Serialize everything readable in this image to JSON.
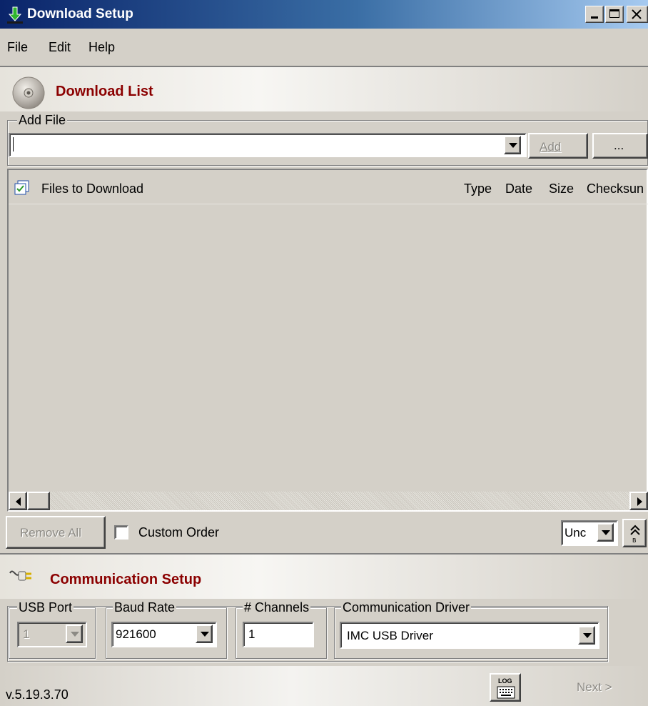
{
  "window": {
    "title": "Download Setup"
  },
  "menu": [
    "File",
    "Edit",
    "Help"
  ],
  "download_section": {
    "title": "Download List"
  },
  "add_file": {
    "label": "Add File",
    "value": "",
    "add_label": "Add",
    "browse_label": "..."
  },
  "list": {
    "columns": [
      "Files to Download",
      "Type",
      "Date",
      "Size",
      "Checksun"
    ]
  },
  "actions": {
    "remove_all": "Remove All",
    "custom_order": "Custom Order",
    "order_value": "Unc"
  },
  "comm_section": {
    "title": "Communication Setup"
  },
  "comm": {
    "usb_port_label": "USB Port",
    "usb_port_value": "1",
    "baud_rate_label": "Baud Rate",
    "baud_rate_value": "921600",
    "channels_label": "# Channels",
    "channels_value": "1",
    "driver_label": "Communication Driver",
    "driver_value": "IMC USB Driver"
  },
  "footer": {
    "version": "v.5.19.3.70",
    "log_label": "LOG",
    "next_label": "Next >"
  }
}
